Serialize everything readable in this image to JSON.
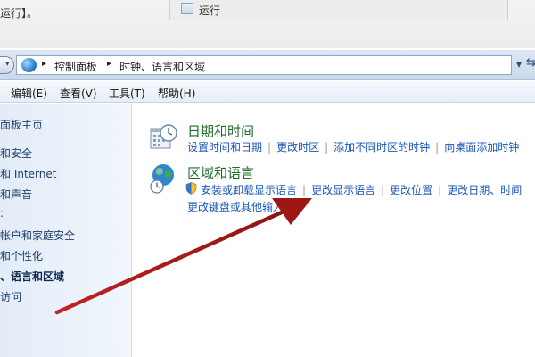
{
  "background": {
    "doc_fragment": "运行】。",
    "run_label": "运行"
  },
  "address_bar": {
    "crumbs": [
      "控制面板",
      "时钟、语言和区域"
    ]
  },
  "menu": {
    "items": [
      "编辑(E)",
      "查看(V)",
      "工具(T)",
      "帮助(H)"
    ]
  },
  "sidebar": {
    "items": [
      {
        "label": "面板主页"
      },
      {
        "label": "和安全"
      },
      {
        "label": "和 Internet"
      },
      {
        "label": "和声音"
      },
      {
        "label": "帐户和家庭安全"
      },
      {
        "label": "和个性化"
      },
      {
        "label": "、语言和区域",
        "current": true
      },
      {
        "label": "访问"
      }
    ]
  },
  "categories": {
    "datetime": {
      "title": "日期和时间",
      "links": [
        "设置时间和日期",
        "更改时区",
        "添加不同时区的时钟",
        "向桌面添加时钟"
      ]
    },
    "region": {
      "title": "区域和语言",
      "links_row1": [
        "安装或卸载显示语言",
        "更改显示语言",
        "更改位置",
        "更改日期、时间"
      ],
      "links_row2": [
        "更改键盘或其他输入"
      ]
    }
  },
  "colors": {
    "arrow": "#b31b1b",
    "category_title": "#1e6e2a",
    "link": "#1a56b8"
  }
}
